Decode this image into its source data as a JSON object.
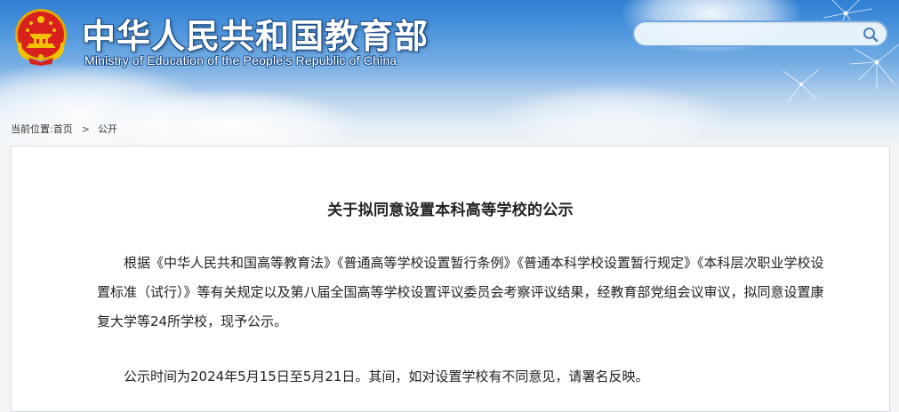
{
  "header": {
    "title_cn": "中华人民共和国教育部",
    "title_en": "Ministry of Education of the People's Republic of China",
    "search": {
      "placeholder": "",
      "value": ""
    }
  },
  "breadcrumb": {
    "label": "当前位置:",
    "items": [
      "首页",
      "公开"
    ],
    "separator": ">"
  },
  "article": {
    "title": "关于拟同意设置本科高等学校的公示",
    "paragraphs": [
      "根据《中华人民共和国高等教育法》《普通高等学校设置暂行条例》《普通本科学校设置暂行规定》《本科层次职业学校设置标准（试行）》等有关规定以及第八届全国高等学校设置评议委员会考察评议结果，经教育部党组会议审议，拟同意设置康复大学等24所学校，现予公示。",
      "公示时间为2024年5月15日至5月21日。其间，如对设置学校有不同意见，请署名反映。"
    ]
  },
  "icons": {
    "emblem": "national-emblem",
    "search": "search-icon"
  },
  "colors": {
    "header_blue": "#2f7fd3",
    "text": "#222222",
    "emblem_red": "#d8201c",
    "emblem_gold": "#f2c200"
  }
}
